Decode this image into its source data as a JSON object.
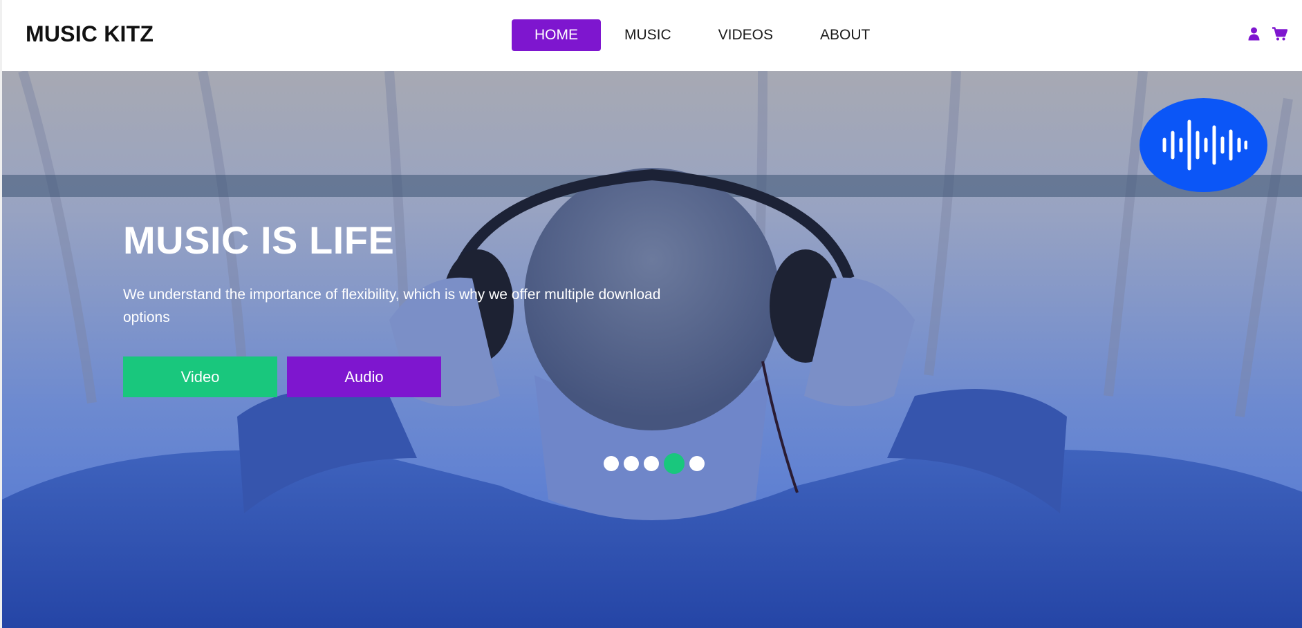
{
  "header": {
    "brand": "MUSIC KITZ",
    "nav": [
      {
        "label": "HOME",
        "active": true
      },
      {
        "label": "MUSIC",
        "active": false
      },
      {
        "label": "VIDEOS",
        "active": false
      },
      {
        "label": "ABOUT",
        "active": false
      }
    ],
    "icons": [
      "user-icon",
      "cart-icon"
    ]
  },
  "hero": {
    "title": "MUSIC IS LIFE",
    "text": "We understand the importance of flexibility, which is why we offer multiple download options",
    "buttons": {
      "video": "Video",
      "audio": "Audio"
    },
    "badge_icon": "sound-wave-icon",
    "carousel": {
      "slides": 5,
      "active_index": 3
    }
  },
  "colors": {
    "accent_purple": "#7e16cf",
    "accent_green": "#19c77d",
    "badge_blue": "#0b56f7"
  }
}
